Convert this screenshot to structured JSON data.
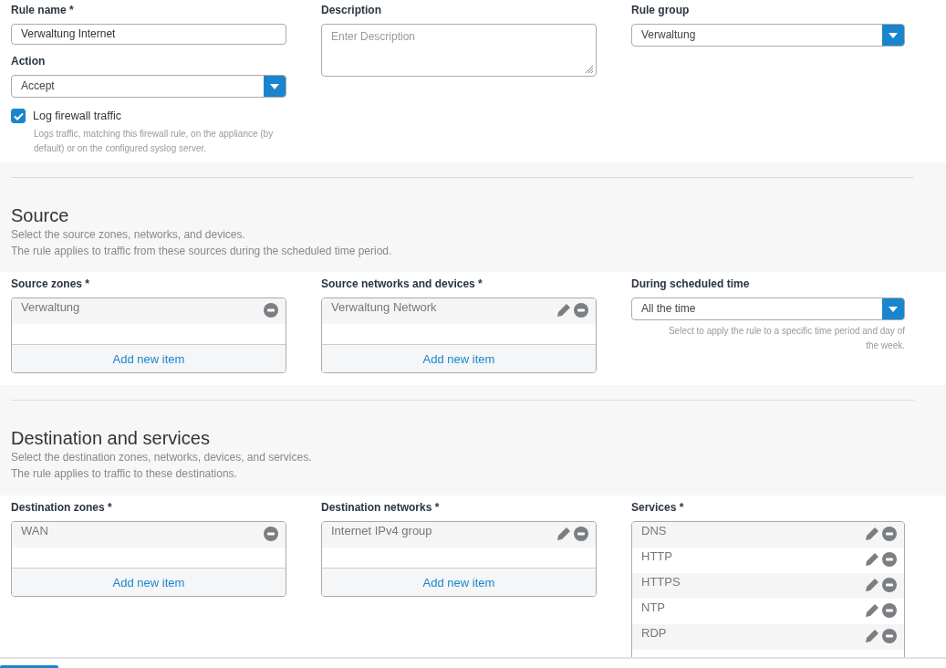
{
  "rule": {
    "name_label": "Rule name *",
    "name_value": "Verwaltung Internet",
    "action_label": "Action",
    "action_value": "Accept",
    "log": {
      "label": "Log firewall traffic",
      "checked": true,
      "hint": "Logs traffic, matching this firewall rule, on the appliance (by default) or on the configured syslog server."
    },
    "description_label": "Description",
    "description_placeholder": "Enter Description",
    "group_label": "Rule group",
    "group_value": "Verwaltung"
  },
  "sections": [
    {
      "title": "Source",
      "lines": [
        "Select the source zones, networks, and devices.",
        "The rule applies to traffic from these sources during the scheduled time period."
      ],
      "fields": [
        {
          "kind": "list",
          "label": "Source zones *",
          "items": [
            {
              "text": "Verwaltung",
              "editable": false
            }
          ],
          "add": "Add new item"
        },
        {
          "kind": "list",
          "label": "Source networks and devices *",
          "items": [
            {
              "text": "Verwaltung Network",
              "editable": true
            }
          ],
          "add": "Add new item"
        },
        {
          "kind": "select",
          "label": "During scheduled time",
          "value": "All the time",
          "hint": "Select to apply the rule to a specific time period and day of the week."
        }
      ]
    },
    {
      "title": "Destination and services",
      "lines": [
        "Select the destination zones, networks, devices, and services.",
        "The rule applies to traffic to these destinations."
      ],
      "fields": [
        {
          "kind": "list",
          "label": "Destination zones *",
          "items": [
            {
              "text": "WAN",
              "editable": false
            }
          ],
          "add": "Add new item"
        },
        {
          "kind": "list",
          "label": "Destination networks *",
          "items": [
            {
              "text": "Internet IPv4 group",
              "editable": true
            }
          ],
          "add": "Add new item"
        },
        {
          "kind": "list",
          "label": "Services *",
          "items": [
            {
              "text": "DNS",
              "editable": true
            },
            {
              "text": "HTTP",
              "editable": true
            },
            {
              "text": "HTTPS",
              "editable": true
            },
            {
              "text": "NTP",
              "editable": true
            },
            {
              "text": "RDP",
              "editable": true
            }
          ]
        }
      ]
    }
  ]
}
